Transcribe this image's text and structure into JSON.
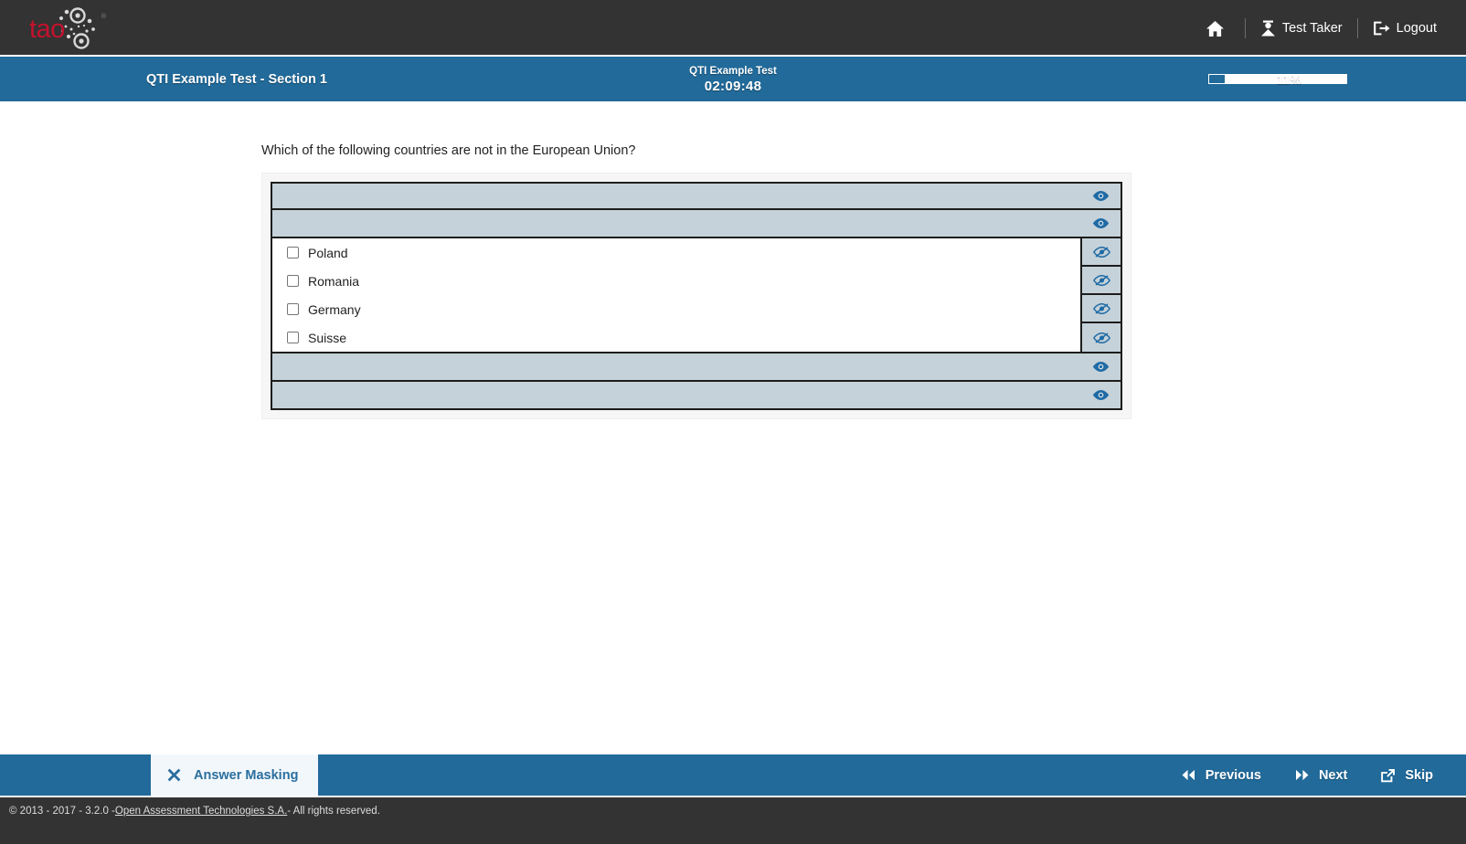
{
  "header": {
    "logo_text": "tao",
    "logo_tm": "®",
    "actions": [
      {
        "label": "",
        "icon": "home-icon"
      },
      {
        "label": "Test Taker",
        "icon": "user-icon"
      },
      {
        "label": "Logout",
        "icon": "logout-icon"
      }
    ],
    "home_label": "",
    "test_taker_label": "Test Taker",
    "logout_label": "Logout"
  },
  "titlebar": {
    "section_title": "QTI Example Test - Section 1",
    "test_name": "QTI Example Test",
    "timer": "02:09:48",
    "progress_percent_label": "11%",
    "progress_percent_value": 11,
    "accent_color": "#216a9a"
  },
  "item": {
    "prompt": "Which of the following countries are not in the European Union?",
    "masked_rows_top": [
      {
        "id": "masked-row-1",
        "icon": "eye-icon"
      },
      {
        "id": "masked-row-2",
        "icon": "eye-icon"
      }
    ],
    "choices": [
      {
        "label": "Poland",
        "checked": false,
        "icon": "eye-slash-icon"
      },
      {
        "label": "Romania",
        "checked": false,
        "icon": "eye-slash-icon"
      },
      {
        "label": "Germany",
        "checked": false,
        "icon": "eye-slash-icon"
      },
      {
        "label": "Suisse",
        "checked": false,
        "icon": "eye-slash-icon"
      }
    ],
    "masked_rows_bottom": [
      {
        "id": "masked-row-3",
        "icon": "eye-icon"
      },
      {
        "id": "masked-row-4",
        "icon": "eye-icon"
      }
    ],
    "mask_color": "#c5d2d9"
  },
  "actionbar": {
    "masking_label": "Answer Masking",
    "masking_icon": "close-x-icon",
    "previous_label": "Previous",
    "next_label": "Next",
    "skip_label": "Skip"
  },
  "footer": {
    "copyright_prefix": "© 2013 - 2017 - 3.2.0 - ",
    "company_link": "Open Assessment Technologies S.A.",
    "copyright_suffix": " - All rights reserved."
  }
}
